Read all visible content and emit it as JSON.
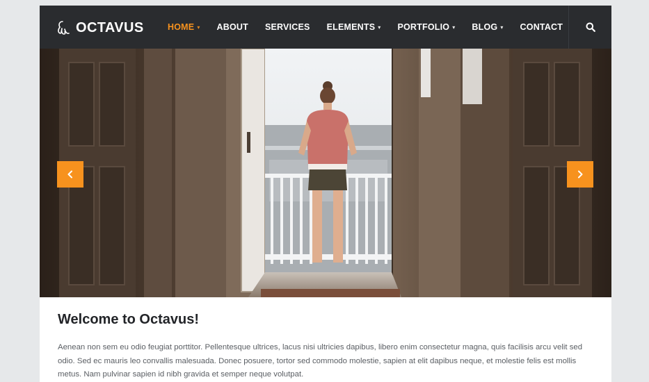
{
  "brand": {
    "name": "OCTAVUS",
    "icon": "octopus-icon"
  },
  "nav": {
    "items": [
      {
        "label": "HOME",
        "has_dropdown": true,
        "active": true
      },
      {
        "label": "ABOUT",
        "has_dropdown": false,
        "active": false
      },
      {
        "label": "SERVICES",
        "has_dropdown": false,
        "active": false
      },
      {
        "label": "ELEMENTS",
        "has_dropdown": true,
        "active": false
      },
      {
        "label": "PORTFOLIO",
        "has_dropdown": true,
        "active": false
      },
      {
        "label": "BLOG",
        "has_dropdown": true,
        "active": false
      },
      {
        "label": "CONTACT",
        "has_dropdown": false,
        "active": false
      }
    ],
    "search_icon": "search-icon"
  },
  "slider": {
    "prev_icon": "chevron-left-icon",
    "next_icon": "chevron-right-icon"
  },
  "content": {
    "heading": "Welcome to Octavus!",
    "paragraph": "Aenean non sem eu odio feugiat porttitor. Pellentesque ultrices, lacus nisi ultricies dapibus, libero enim consectetur magna, quis facilisis arcu velit sed odio. Sed ec mauris leo convallis malesuada. Donec posuere, tortor sed commodo molestie, sapien at elit dapibus neque, et molestie felis est mollis metus. Nam pulvinar sapien id nibh gravida et semper neque volutpat."
  },
  "colors": {
    "accent": "#f7921e",
    "header_bg": "#2a2c2f",
    "page_bg": "#e6e8ea",
    "heading": "#222428",
    "body_text": "#5a5e63"
  }
}
